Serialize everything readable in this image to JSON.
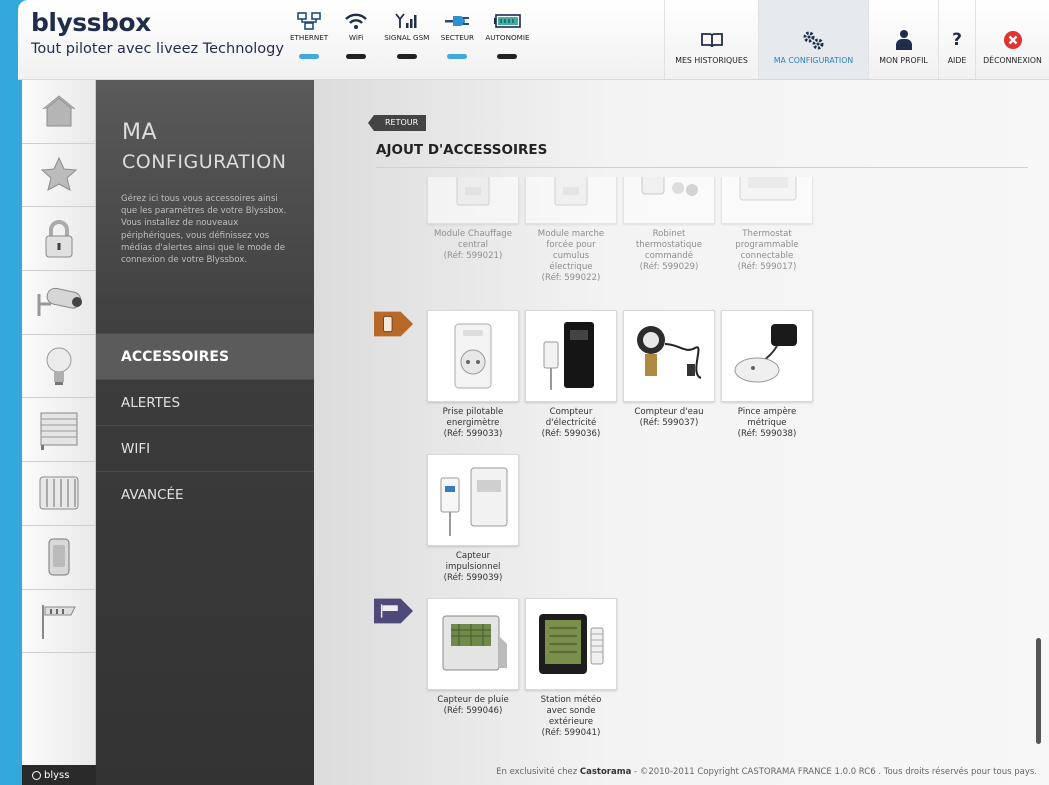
{
  "logo": {
    "main": "blyssbox",
    "sub": "Tout piloter avec liveez Technology"
  },
  "status": [
    {
      "label": "ETHERNET",
      "icon": "ethernet-icon",
      "on": true
    },
    {
      "label": "WiFi",
      "icon": "wifi-icon",
      "on": false
    },
    {
      "label": "SIGNAL GSM",
      "icon": "signal-gsm-icon",
      "on": false
    },
    {
      "label": "SECTEUR",
      "icon": "plug-icon",
      "on": true
    },
    {
      "label": "AUTONOMIE",
      "icon": "battery-icon",
      "on": false
    }
  ],
  "nav": [
    {
      "label": "MES HISTORIQUES",
      "icon": "book-icon"
    },
    {
      "label": "MA CONFIGURATION",
      "icon": "gears-icon"
    },
    {
      "label": "MON PROFIL",
      "icon": "user-icon"
    },
    {
      "label": "AIDE",
      "icon": "help-icon"
    },
    {
      "label": "DÉCONNEXION",
      "icon": "close-icon"
    }
  ],
  "sidebar_icons": [
    "home-icon",
    "star-icon",
    "lock-icon",
    "camera-icon",
    "bulb-icon",
    "shutter-icon",
    "radiator-icon",
    "sensor-icon",
    "weather-icon"
  ],
  "sidebar_footer": "blyss",
  "menu": {
    "title1": "MA",
    "title2": "CONFIGURATION",
    "description": "Gérez ici tous vous accessoires ainsi que les paramètres de votre Blyssbox. Vous installez de nouveaux périphériques, vous définissez vos médias d'alertes ainsi que le mode de connexion de votre Blyssbox.",
    "items": [
      "ACCESSOIRES",
      "ALERTES",
      "WIFI",
      "AVANCÉE"
    ]
  },
  "main": {
    "back": "RETOUR",
    "title": "AJOUT D'ACCESSOIRES",
    "footer_prefix": "En exclusivité chez",
    "footer_brand": "Castorama",
    "footer_suffix": "- ©2010-2011 Copyright CASTORAMA FRANCE 1.0.0 RC6 . Tous droits réservés pour tous pays."
  },
  "heating_products": [
    {
      "l1": "Module Chauffage",
      "l2": "central",
      "l3": "(Réf: 599021)",
      "l4": "",
      "l5": ""
    },
    {
      "l1": "Module marche",
      "l2": "forcée pour",
      "l3": "cumulus",
      "l4": "électrique",
      "l5": "(Réf: 599022)"
    },
    {
      "l1": "Robinet",
      "l2": "thermostatique",
      "l3": "commandé",
      "l4": "(Réf: 599029)",
      "l5": ""
    },
    {
      "l1": "Thermostat",
      "l2": "programmable",
      "l3": "connectable",
      "l4": "(Réf: 599017)",
      "l5": ""
    }
  ],
  "energy_products": [
    {
      "l1": "Prise pilotable",
      "l2": "energimètre",
      "l3": "(Réf: 599033)"
    },
    {
      "l1": "Compteur",
      "l2": "d'électricité",
      "l3": "(Réf: 599036)"
    },
    {
      "l1": "Compteur d'eau",
      "l2": "(Réf: 599037)",
      "l3": ""
    },
    {
      "l1": "Pince ampère",
      "l2": "métrique",
      "l3": "(Réf: 599038)"
    },
    {
      "l1": "Capteur",
      "l2": "impulsionnel",
      "l3": "(Réf: 599039)"
    }
  ],
  "weather_products": [
    {
      "l1": "Capteur de pluie",
      "l2": "(Réf: 599046)",
      "l3": "",
      "l4": ""
    },
    {
      "l1": "Station météo",
      "l2": "avec sonde",
      "l3": "extérieure",
      "l4": "(Réf: 599041)"
    }
  ],
  "colors": {
    "accent": "#3fa9e0",
    "energy_badge": "#b8692a",
    "weather_badge": "#4d4a7a"
  }
}
